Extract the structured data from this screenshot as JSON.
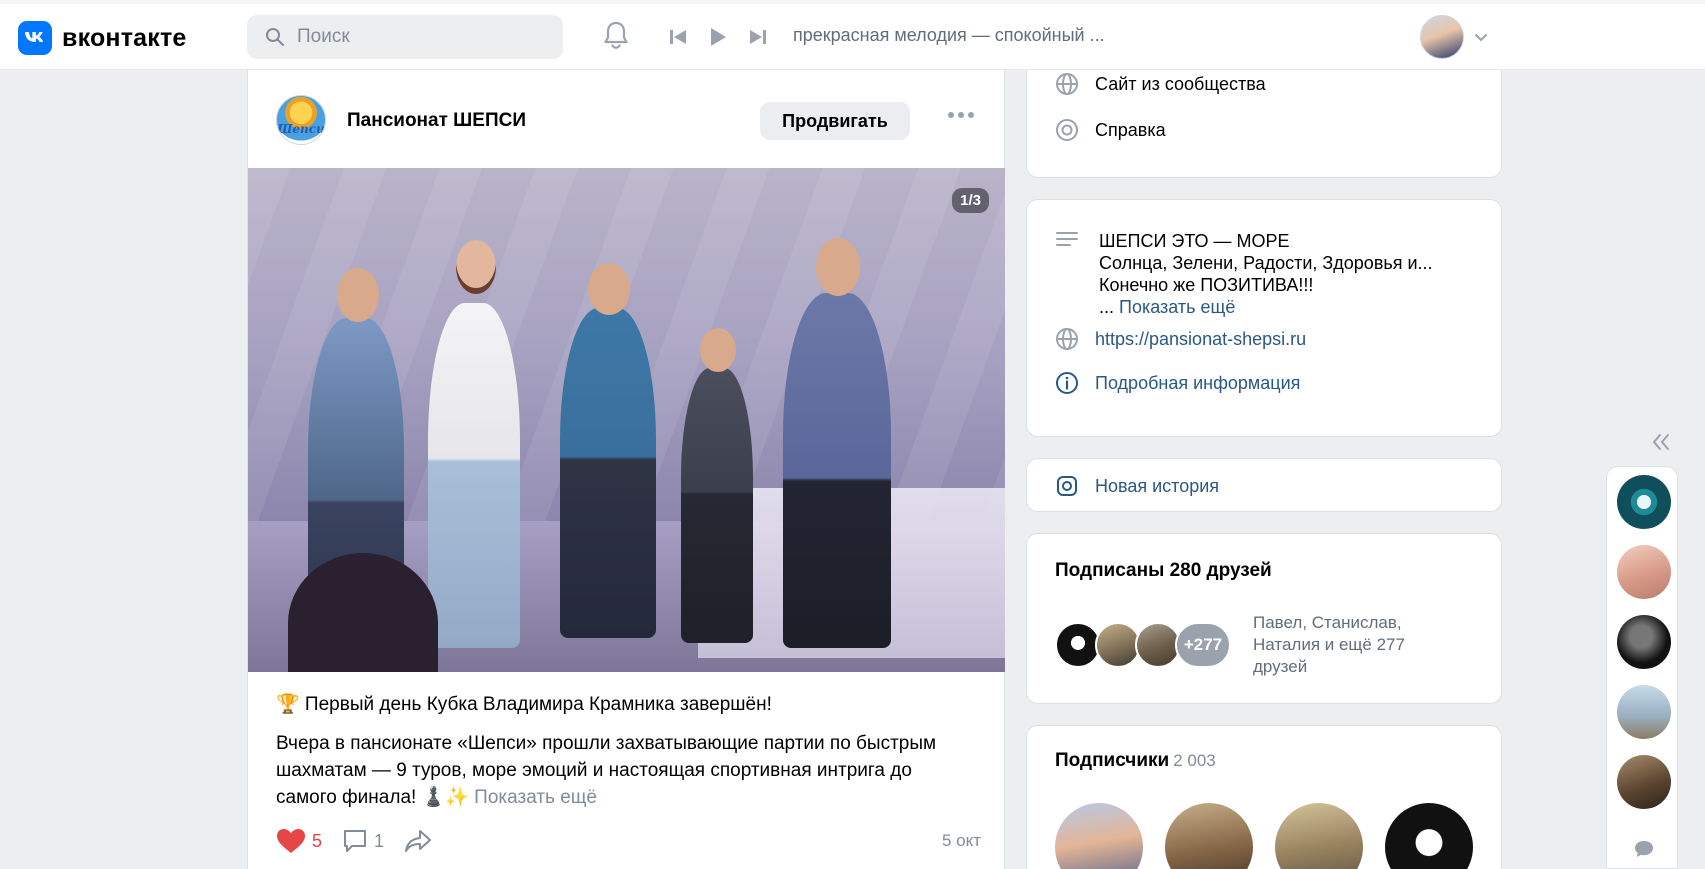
{
  "header": {
    "logo_text": "вконтакте",
    "logo_mark": "vk",
    "search_placeholder": "Поиск",
    "track": "прекрасная мелодия — спокойный ...",
    "icons": [
      "search-icon",
      "bell-icon",
      "prev-track-icon",
      "play-icon",
      "next-track-icon",
      "chevron-down-icon"
    ]
  },
  "post": {
    "group_name": "Пансионат ШЕПСИ",
    "group_logo_text": "Шепси",
    "promote_label": "Продвигать",
    "photo_counter": "1/3",
    "title": "🏆 Первый день Кубка Владимира Крамника завершён!",
    "body": "Вчера в пансионате «Шепси» прошли захватывающие партии по быстрым шахматам — 9 туров, море эмоций и настоящая спортивная интрига до самого финала! ♟️✨",
    "show_more": "Показать ещё",
    "likes": "5",
    "comments": "1",
    "date": "5 окт"
  },
  "links_card": {
    "items": [
      {
        "label": "Сайт из сообщества",
        "icon": "globe-icon"
      },
      {
        "label": "Справка",
        "icon": "help-lifebuoy-icon"
      }
    ]
  },
  "info_card": {
    "description_lines": [
      "ШЕПСИ ЭТО — МОРЕ",
      "Солнца, Зелени, Радости, Здоровья и...",
      "Конечно же ПОЗИТИВА!!!"
    ],
    "ellipsis": "...",
    "show_more": "Показать ещё",
    "website": "https://pansionat-shepsi.ru",
    "details": "Подробная информация"
  },
  "story_card": {
    "label": "Новая история"
  },
  "friends_card": {
    "title": "Подписаны 280 друзей",
    "more_badge": "+277",
    "names": "Павел, Станислав, Наталия и ещё 277 друзей"
  },
  "subscribers_card": {
    "title": "Подписчики",
    "count": "2 003"
  },
  "colors": {
    "accent": "#0077ff",
    "link": "#2a5885",
    "like": "#e64646",
    "background": "#edeef0"
  }
}
